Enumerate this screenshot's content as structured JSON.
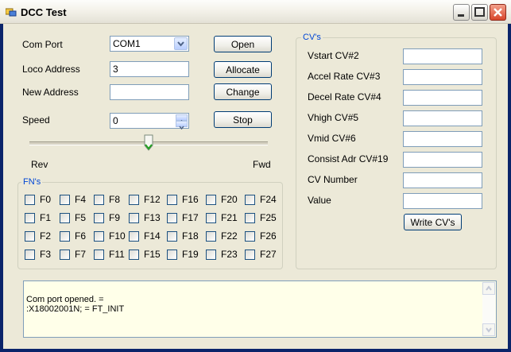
{
  "window": {
    "title": "DCC Test"
  },
  "controls": {
    "com_port_label": "Com Port",
    "com_port_value": "COM1",
    "loco_address_label": "Loco Address",
    "loco_address_value": "3",
    "new_address_label": "New Address",
    "new_address_value": "",
    "speed_label": "Speed",
    "speed_value": "0",
    "speed_slider_fraction": 0.5,
    "rev_label": "Rev",
    "fwd_label": "Fwd"
  },
  "buttons": {
    "open": "Open",
    "allocate": "Allocate",
    "change": "Change",
    "stop": "Stop",
    "write_cvs": "Write CV's"
  },
  "fns": {
    "title": "FN's",
    "labels": [
      "F0",
      "F4",
      "F8",
      "F12",
      "F16",
      "F20",
      "F24",
      "F1",
      "F5",
      "F9",
      "F13",
      "F17",
      "F21",
      "F25",
      "F2",
      "F6",
      "F10",
      "F14",
      "F18",
      "F22",
      "F26",
      "F3",
      "F7",
      "F11",
      "F15",
      "F19",
      "F23",
      "F27"
    ]
  },
  "cvs": {
    "title": "CV's",
    "rows": [
      {
        "label": "Vstart CV#2",
        "value": ""
      },
      {
        "label": "Accel Rate CV#3",
        "value": ""
      },
      {
        "label": "Decel Rate CV#4",
        "value": ""
      },
      {
        "label": "Vhigh CV#5",
        "value": ""
      },
      {
        "label": "Vmid CV#6",
        "value": ""
      },
      {
        "label": "Consist Adr CV#19",
        "value": ""
      },
      {
        "label": "CV Number",
        "value": ""
      },
      {
        "label": "Value",
        "value": ""
      }
    ]
  },
  "log": {
    "text": "Com port opened. =\n:X18002001N; = FT_INIT"
  },
  "colors": {
    "face": "#ece9d8",
    "accent": "#0046d5",
    "border": "#0a246a"
  }
}
